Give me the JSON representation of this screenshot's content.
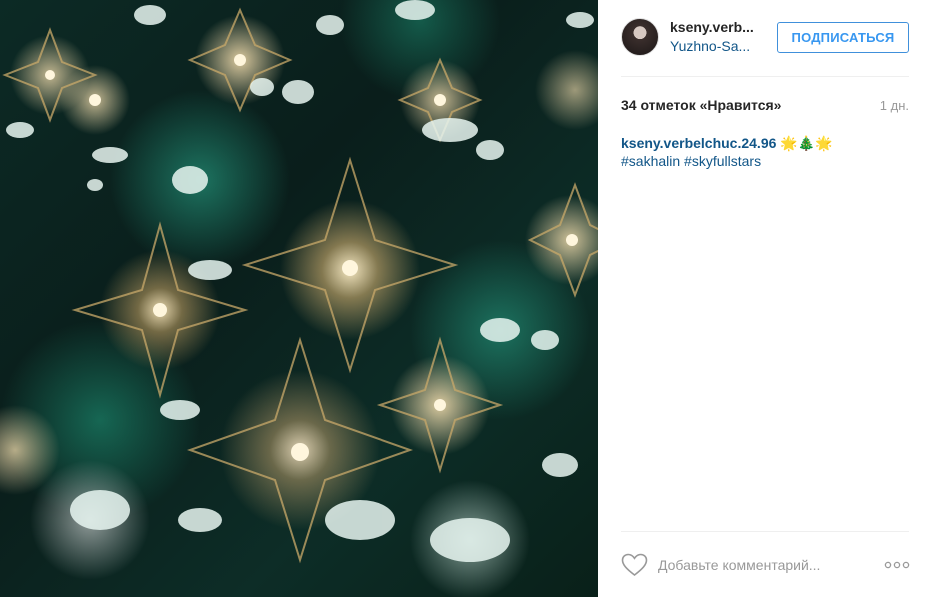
{
  "photo": {
    "icon": "christmas-stars-photo",
    "accent": "#2fb797"
  },
  "header": {
    "username": "kseny.verb...",
    "location": "Yuzhno-Sa...",
    "follow_label": "ПОДПИСАТЬСЯ"
  },
  "stats": {
    "likes": "34 отметок «Нравится»",
    "time": "1 дн."
  },
  "caption": {
    "author": "kseny.verbelchuc.24.96",
    "emoji": "🌟🎄🌟",
    "hashtags": [
      "#sakhalin",
      "#skyfullstars"
    ]
  },
  "footer": {
    "comment_placeholder": "Добавьте комментарий...",
    "heart_icon": "heart-icon",
    "more_icon": "more-options-icon"
  },
  "colors": {
    "link": "#125688",
    "button": "#3897f0",
    "muted": "#999999"
  }
}
